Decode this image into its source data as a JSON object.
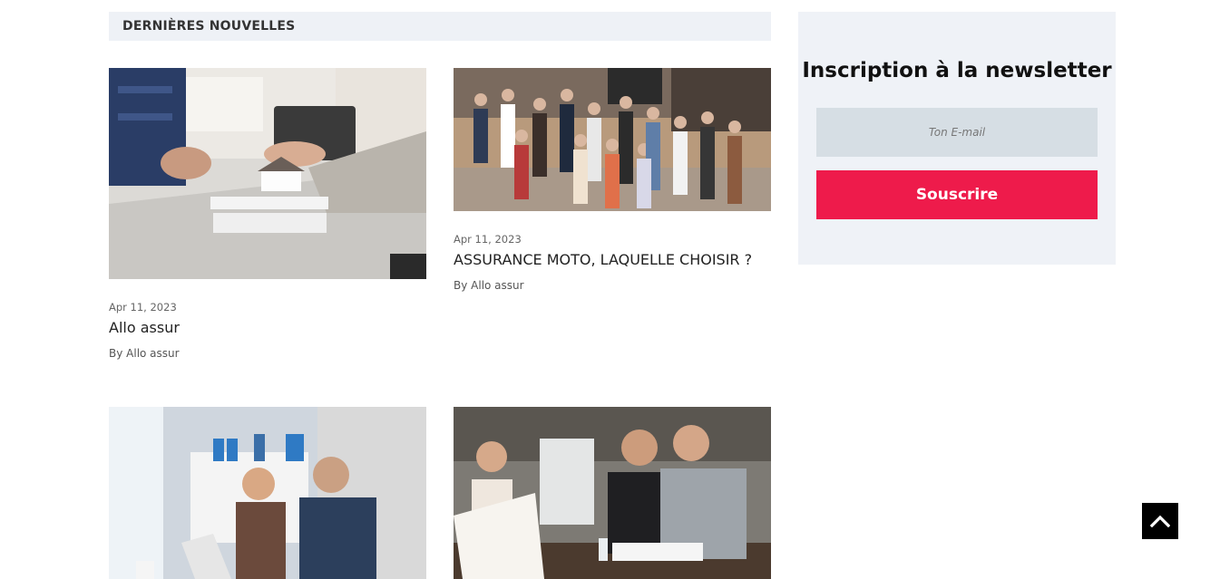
{
  "section": {
    "title": "DERNIÈRES NOUVELLES"
  },
  "posts": [
    {
      "date": "Apr 11, 2023",
      "title": "Allo assur",
      "author": "By Allo assur",
      "image": "real-estate-meeting-photo"
    },
    {
      "date": "Apr 11, 2023",
      "title": "ASSURANCE MOTO, LAQUELLE CHOISIR ?",
      "author": "By Allo assur",
      "image": "crowd-networking-event-photo"
    },
    {
      "image": "business-men-at-laptop-photo"
    },
    {
      "image": "business-meeting-table-photo"
    }
  ],
  "newsletter": {
    "heading": "Inscription à la newsletter",
    "email_placeholder": "Ton E-mail",
    "subscribe_label": "Souscrire"
  },
  "scroll_top": {
    "icon": "chevron-up-icon"
  },
  "colors": {
    "accent": "#ee1b4b",
    "panel": "#eff2f7",
    "input": "#d6dee4"
  }
}
